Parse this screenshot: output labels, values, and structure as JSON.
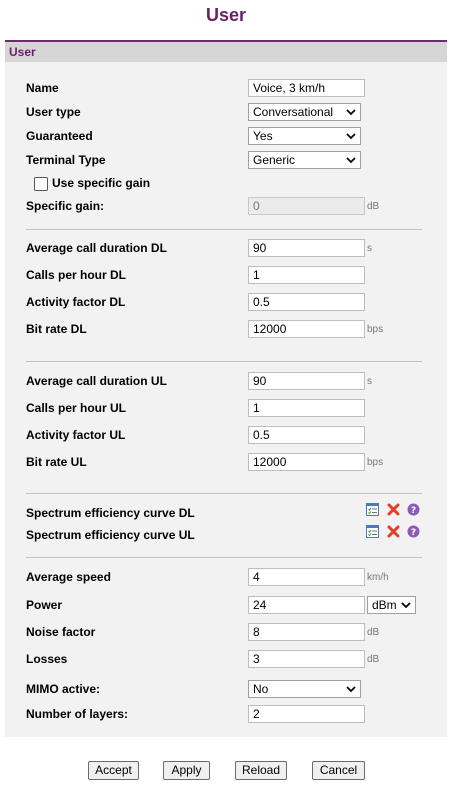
{
  "title": "User",
  "panel": {
    "header": "User"
  },
  "general": {
    "name": {
      "label": "Name",
      "value": "Voice, 3 km/h"
    },
    "user_type": {
      "label": "User type",
      "value": "Conversational"
    },
    "guaranteed": {
      "label": "Guaranteed",
      "value": "Yes"
    },
    "terminal_type": {
      "label": "Terminal Type",
      "value": "Generic"
    },
    "use_specific_gain": {
      "label": "Use specific gain",
      "checked": false
    },
    "specific_gain": {
      "label": "Specific gain:",
      "value": "0",
      "unit": "dB"
    }
  },
  "downlink": {
    "avg_call_duration": {
      "label": "Average call duration DL",
      "value": "90",
      "unit": "s"
    },
    "calls_per_hour": {
      "label": "Calls per hour DL",
      "value": "1"
    },
    "activity_factor": {
      "label": "Activity factor DL",
      "value": "0.5"
    },
    "bit_rate": {
      "label": "Bit rate DL",
      "value": "12000",
      "unit": "bps"
    }
  },
  "uplink": {
    "avg_call_duration": {
      "label": "Average call duration UL",
      "value": "90",
      "unit": "s"
    },
    "calls_per_hour": {
      "label": "Calls per hour UL",
      "value": "1"
    },
    "activity_factor": {
      "label": "Activity factor UL",
      "value": "0.5"
    },
    "bit_rate": {
      "label": "Bit rate UL",
      "value": "12000",
      "unit": "bps"
    }
  },
  "spectrum": {
    "dl": {
      "label": "Spectrum efficiency curve DL",
      "icons": [
        "edit-list-icon",
        "delete-icon",
        "help-icon"
      ]
    },
    "ul": {
      "label": "Spectrum efficiency curve UL",
      "icons": [
        "edit-list-icon",
        "delete-icon",
        "help-icon"
      ]
    }
  },
  "radio": {
    "avg_speed": {
      "label": "Average speed",
      "value": "4",
      "unit": "km/h"
    },
    "power": {
      "label": "Power",
      "value": "24",
      "unit_select": "dBm"
    },
    "noise_factor": {
      "label": "Noise factor",
      "value": "8",
      "unit": "dB"
    },
    "losses": {
      "label": "Losses",
      "value": "3",
      "unit": "dB"
    },
    "mimo_active": {
      "label": "MIMO active:",
      "value": "No"
    },
    "num_layers": {
      "label": "Number of layers:",
      "value": "2"
    }
  },
  "buttons": {
    "accept": "Accept",
    "apply": "Apply",
    "reload": "Reload",
    "cancel": "Cancel"
  },
  "colors": {
    "title": "#6b1f6b",
    "panel_bg": "#f2f2f2",
    "header_bg": "#d6d6d6",
    "delete_red": "#e0402a",
    "help_purple": "#8a5bb8"
  }
}
